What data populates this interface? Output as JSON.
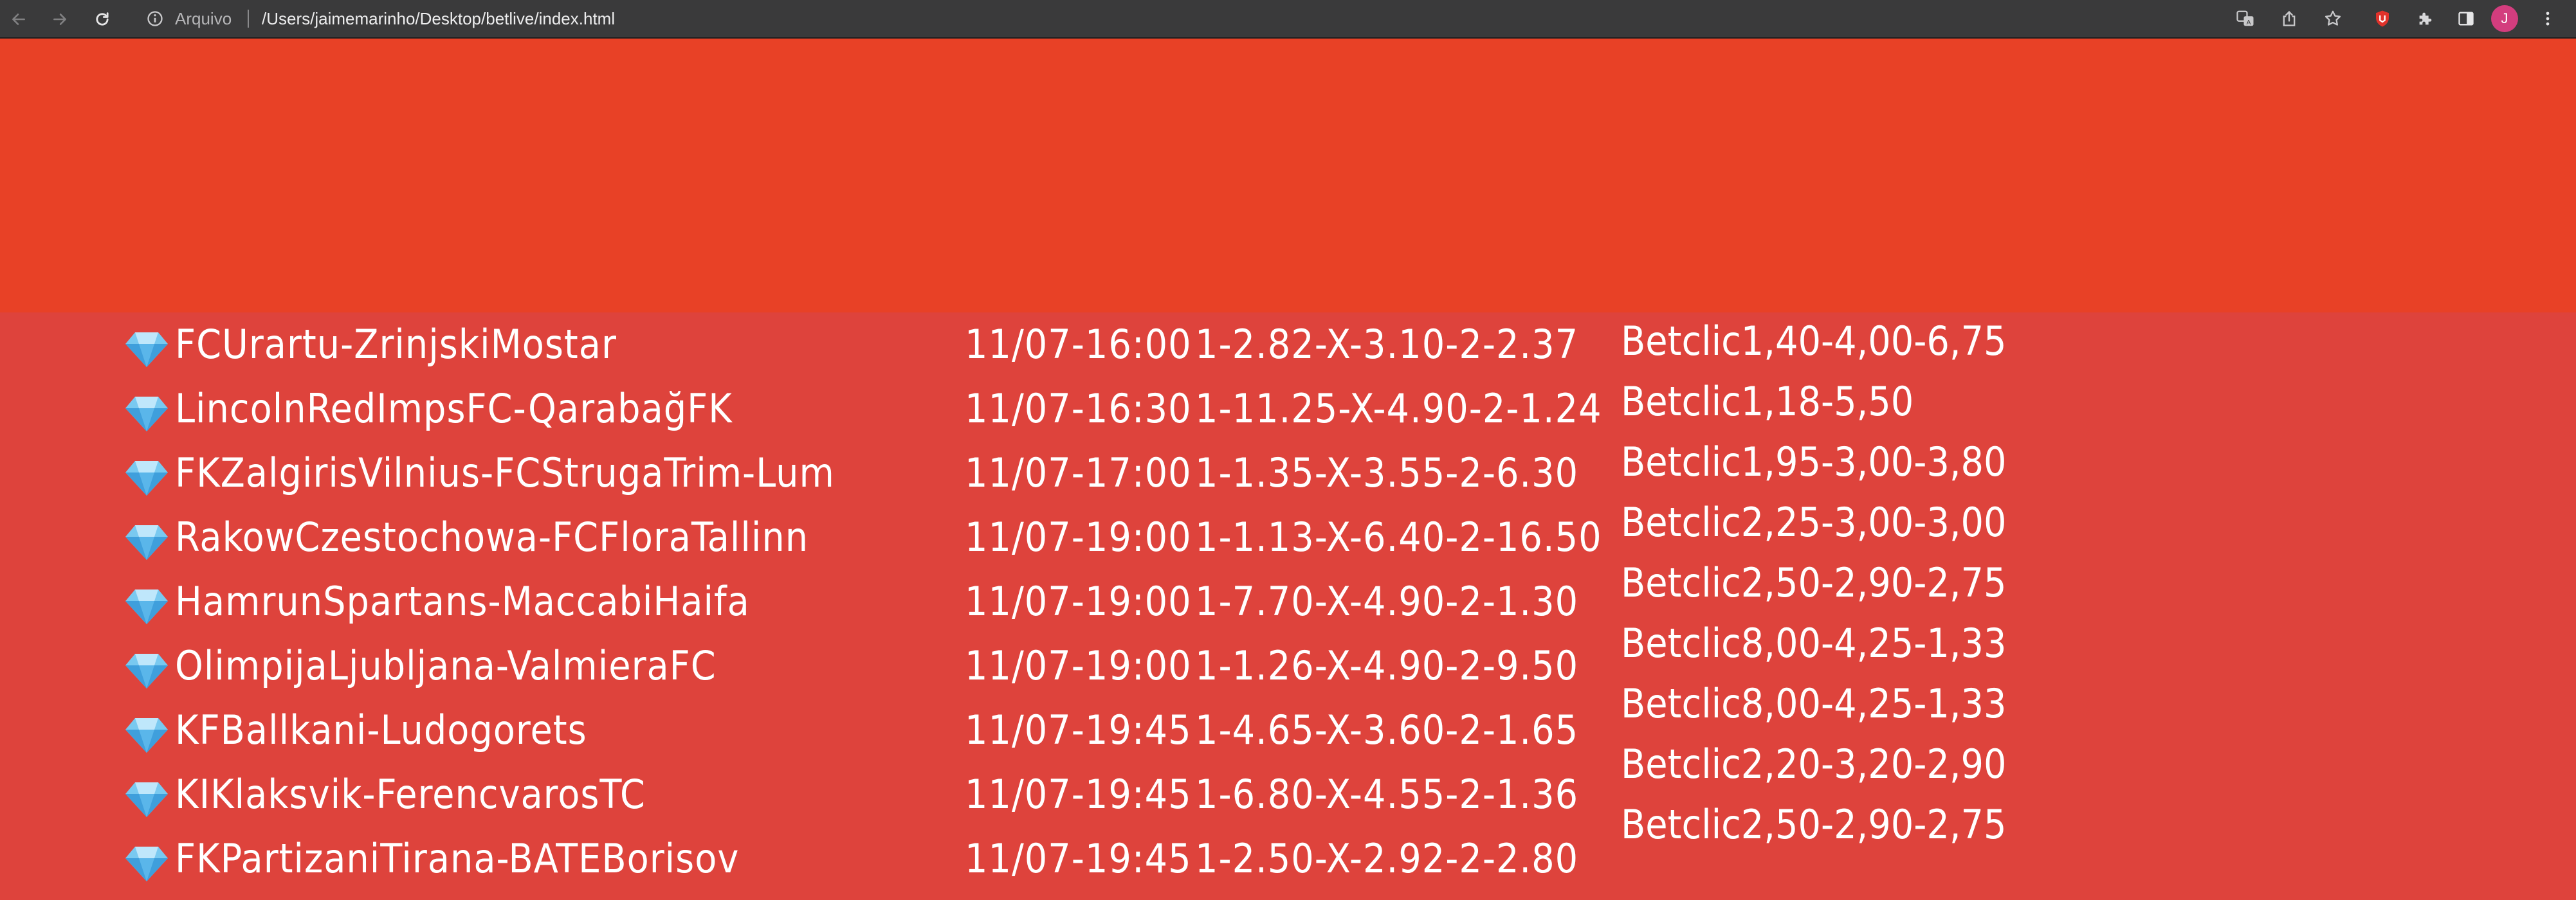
{
  "browser": {
    "scheme_label": "Arquivo",
    "url": "/Users/jaimemarinho/Desktop/betlive/index.html",
    "avatar_letter": "J",
    "icons": {
      "back": "arrow-left-icon",
      "forward": "arrow-right-icon",
      "reload": "reload-icon",
      "info": "info-icon",
      "translate": "translate-icon",
      "share": "share-icon",
      "bookmark": "star-icon",
      "extension": "shield-extension-icon",
      "extensions": "puzzle-icon",
      "side_panel": "side-panel-icon",
      "menu": "kebab-menu-icon"
    }
  },
  "colors": {
    "banner": "#e84126",
    "list_background": "#de433c",
    "text": "#ffffff"
  },
  "matches": [
    {
      "gem_icon": "gem-icon",
      "teams": "FCUrartu-ZrinjskiMostar",
      "time": "11/07-16:00",
      "odds": "1-2.82-X-3.10-2-2.37"
    },
    {
      "gem_icon": "gem-icon",
      "teams": "LincolnRedImpsFC-QarabağFK",
      "time": "11/07-16:30",
      "odds": "1-11.25-X-4.90-2-1.24"
    },
    {
      "gem_icon": "gem-icon",
      "teams": "FKZalgirisVilnius-FCStrugaTrim-Lum",
      "time": "11/07-17:00",
      "odds": "1-1.35-X-3.55-2-6.30"
    },
    {
      "gem_icon": "gem-icon",
      "teams": "RakowCzestochowa-FCFloraTallinn",
      "time": "11/07-19:00",
      "odds": "1-1.13-X-6.40-2-16.50"
    },
    {
      "gem_icon": "gem-icon",
      "teams": "HamrunSpartans-MaccabiHaifa",
      "time": "11/07-19:00",
      "odds": "1-7.70-X-4.90-2-1.30"
    },
    {
      "gem_icon": "gem-icon",
      "teams": "OlimpijaLjubljana-ValmieraFC",
      "time": "11/07-19:00",
      "odds": "1-1.26-X-4.90-2-9.50"
    },
    {
      "gem_icon": "gem-icon",
      "teams": "KFBallkani-Ludogorets",
      "time": "11/07-19:45",
      "odds": "1-4.65-X-3.60-2-1.65"
    },
    {
      "gem_icon": "gem-icon",
      "teams": "KIKlaksvik-FerencvarosTC",
      "time": "11/07-19:45",
      "odds": "1-6.80-X-4.55-2-1.36"
    },
    {
      "gem_icon": "gem-icon",
      "teams": "FKPartizaniTirana-BATEBorisov",
      "time": "11/07-19:45",
      "odds": "1-2.50-X-2.92-2-2.80"
    }
  ],
  "betclic": [
    "Betclic1,40-4,00-6,75",
    "Betclic1,18-5,50",
    "Betclic1,95-3,00-3,80",
    "Betclic2,25-3,00-3,00",
    "Betclic2,50-2,90-2,75",
    "Betclic8,00-4,25-1,33",
    "Betclic8,00-4,25-1,33",
    "Betclic2,20-3,20-2,90",
    "Betclic2,50-2,90-2,75"
  ]
}
